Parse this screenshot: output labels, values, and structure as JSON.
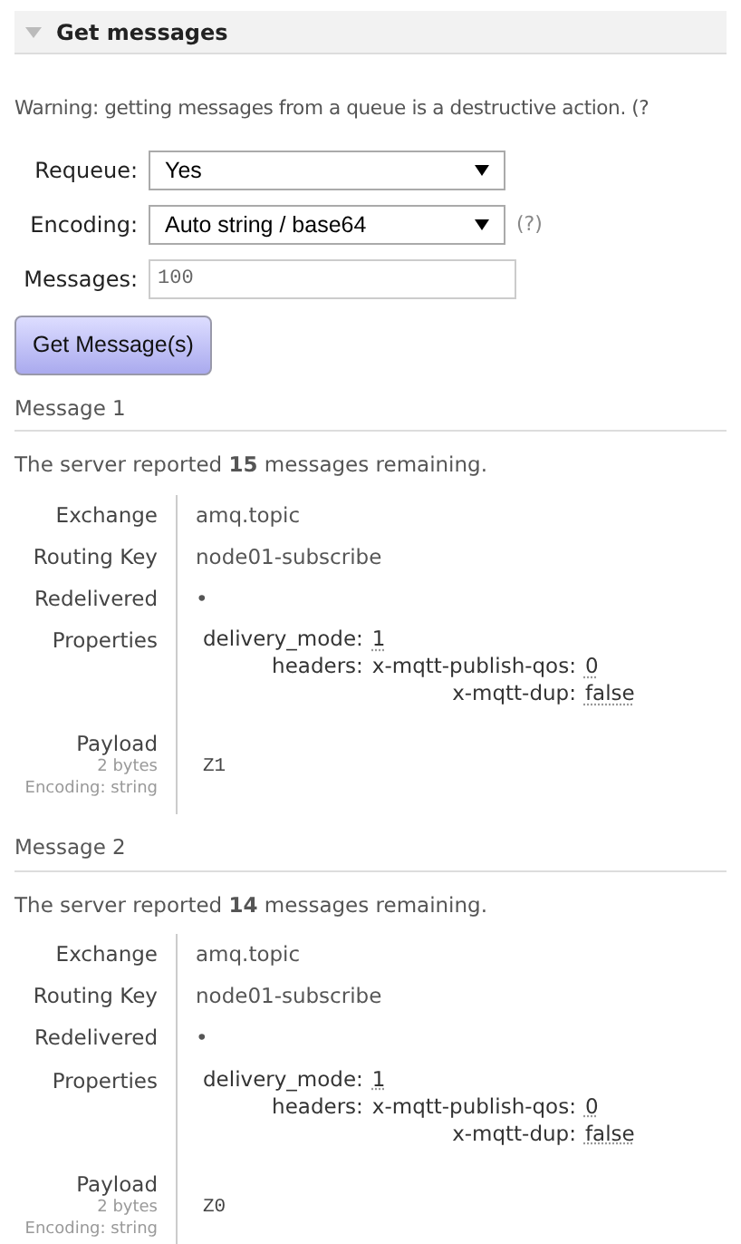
{
  "section": {
    "title": "Get messages",
    "expanded": true
  },
  "warning": "Warning: getting messages from a queue is a destructive action. (?",
  "form": {
    "requeue": {
      "label": "Requeue:",
      "value": "Yes"
    },
    "encoding": {
      "label": "Encoding:",
      "value": "Auto string / base64",
      "help": "(?)"
    },
    "messages": {
      "label": "Messages:",
      "value": "100"
    },
    "button": "Get Message(s)"
  },
  "messages": [
    {
      "title": "Message 1",
      "remaining": "The server reported **15** messages remaining.",
      "fields": [
        {
          "label": "Exchange",
          "value": "amq.topic"
        },
        {
          "label": "Routing Key",
          "value": "node01-subscribe"
        },
        {
          "label": "Redelivered",
          "value": "•"
        }
      ],
      "properties_label": "Properties",
      "properties": [
        {
          "key": "delivery_mode:",
          "value": "1"
        },
        {
          "key": "headers:",
          "children": [
            {
              "key": "x-mqtt-publish-qos:",
              "value": "0"
            },
            {
              "key": "x-mqtt-dup:",
              "value": "false"
            }
          ]
        }
      ],
      "payload": {
        "label": "Payload",
        "size": "2 bytes",
        "encoding": "Encoding: string",
        "value": "Z1"
      }
    },
    {
      "title": "Message 2",
      "remaining": "The server reported **14** messages remaining.",
      "fields": [
        {
          "label": "Exchange",
          "value": "amq.topic"
        },
        {
          "label": "Routing Key",
          "value": "node01-subscribe"
        },
        {
          "label": "Redelivered",
          "value": "•"
        }
      ],
      "properties_label": "Properties",
      "properties": [
        {
          "key": "delivery_mode:",
          "value": "1"
        },
        {
          "key": "headers:",
          "children": [
            {
              "key": "x-mqtt-publish-qos:",
              "value": "0"
            },
            {
              "key": "x-mqtt-dup:",
              "value": "false"
            }
          ]
        }
      ],
      "payload": {
        "label": "Payload",
        "size": "2 bytes",
        "encoding": "Encoding: string",
        "value": "Z0"
      }
    }
  ]
}
